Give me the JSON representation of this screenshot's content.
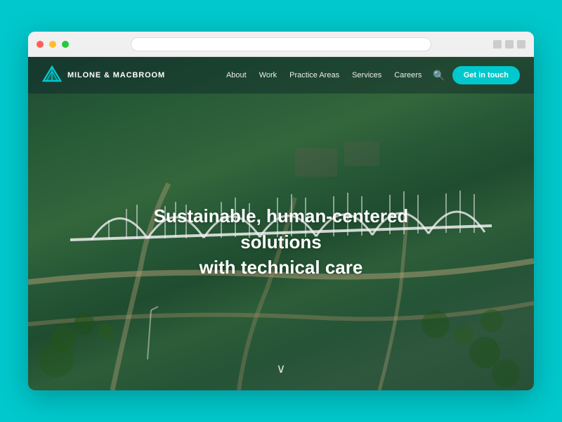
{
  "browser": {
    "traffic_lights": [
      "red",
      "yellow",
      "green"
    ]
  },
  "navbar": {
    "logo_text": "MILONE & MACBROOM",
    "nav_items": [
      {
        "label": "About",
        "id": "about"
      },
      {
        "label": "Work",
        "id": "work"
      },
      {
        "label": "Practice Areas",
        "id": "practice-areas"
      },
      {
        "label": "Services",
        "id": "services"
      },
      {
        "label": "Careers",
        "id": "careers"
      }
    ],
    "cta_label": "Get in touch"
  },
  "hero": {
    "headline_line1": "Sustainable, human-centered solutions",
    "headline_line2": "with technical care",
    "scroll_arrow": "∨"
  },
  "colors": {
    "teal": "#00C8CC",
    "nav_bg": "rgba(10,30,40,0.4)",
    "overlay": "rgba(20,60,60,0.55)"
  }
}
